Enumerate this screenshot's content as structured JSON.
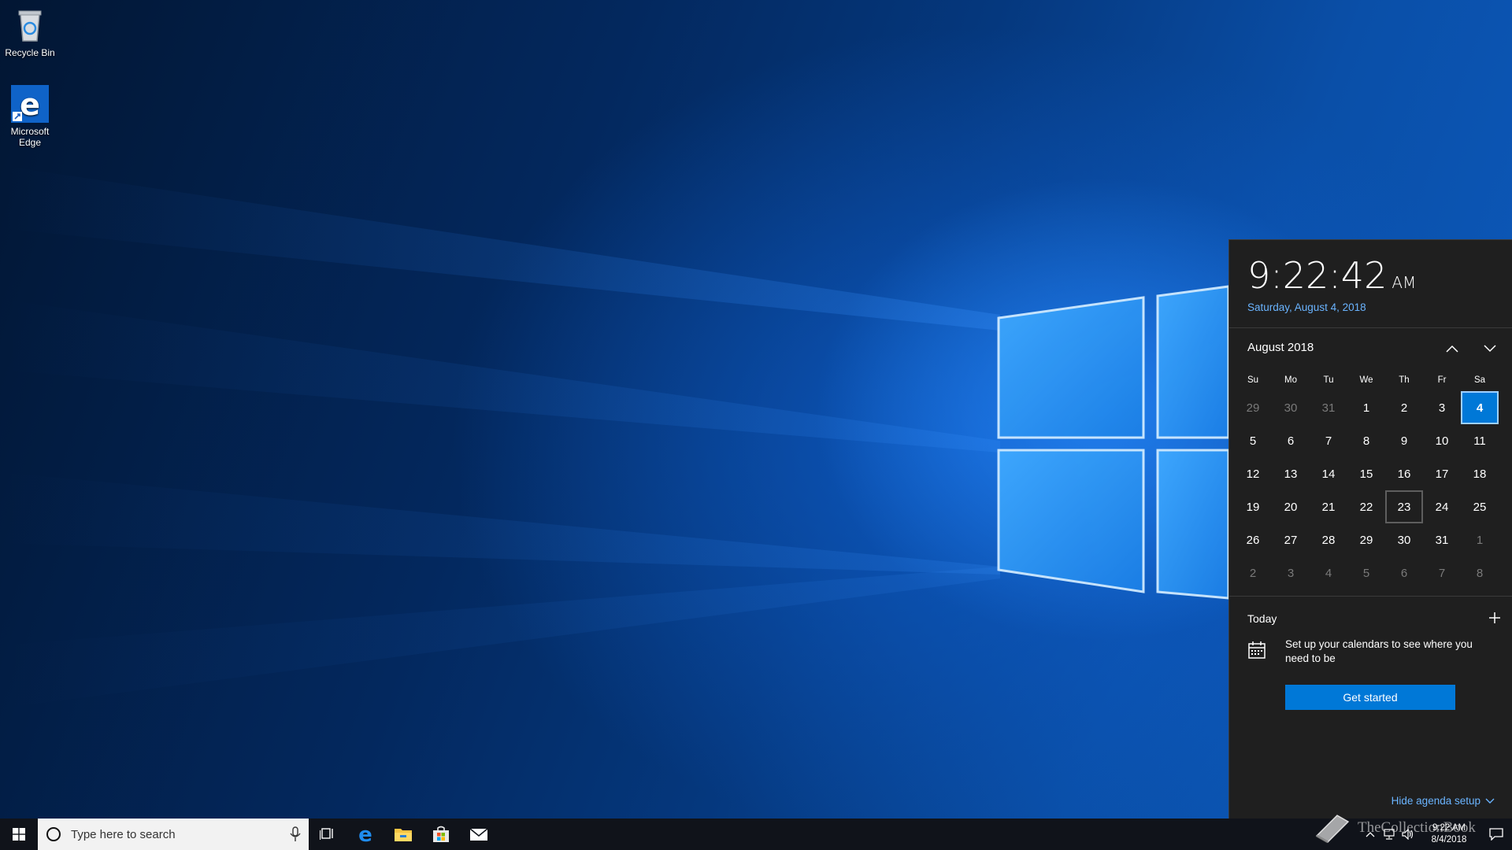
{
  "desktop": {
    "icons": [
      {
        "label": "Recycle Bin",
        "icon": "recycle-bin-icon"
      },
      {
        "label": "Microsoft Edge",
        "icon": "edge-icon"
      }
    ]
  },
  "flyout": {
    "time": "9:22:42",
    "ampm": "AM",
    "long_date": "Saturday, August 4, 2018",
    "month_label": "August 2018",
    "weekdays": [
      "Su",
      "Mo",
      "Tu",
      "We",
      "Th",
      "Fr",
      "Sa"
    ],
    "weeks": [
      [
        {
          "d": "29",
          "dim": true
        },
        {
          "d": "30",
          "dim": true
        },
        {
          "d": "31",
          "dim": true
        },
        {
          "d": "1"
        },
        {
          "d": "2"
        },
        {
          "d": "3"
        },
        {
          "d": "4",
          "today": true
        }
      ],
      [
        {
          "d": "5"
        },
        {
          "d": "6"
        },
        {
          "d": "7"
        },
        {
          "d": "8"
        },
        {
          "d": "9"
        },
        {
          "d": "10"
        },
        {
          "d": "11"
        }
      ],
      [
        {
          "d": "12"
        },
        {
          "d": "13"
        },
        {
          "d": "14"
        },
        {
          "d": "15"
        },
        {
          "d": "16"
        },
        {
          "d": "17"
        },
        {
          "d": "18"
        }
      ],
      [
        {
          "d": "19"
        },
        {
          "d": "20"
        },
        {
          "d": "21"
        },
        {
          "d": "22"
        },
        {
          "d": "23",
          "hover": true
        },
        {
          "d": "24"
        },
        {
          "d": "25"
        }
      ],
      [
        {
          "d": "26"
        },
        {
          "d": "27"
        },
        {
          "d": "28"
        },
        {
          "d": "29"
        },
        {
          "d": "30"
        },
        {
          "d": "31"
        },
        {
          "d": "1",
          "dim": true
        }
      ],
      [
        {
          "d": "2",
          "dim": true
        },
        {
          "d": "3",
          "dim": true
        },
        {
          "d": "4",
          "dim": true
        },
        {
          "d": "5",
          "dim": true
        },
        {
          "d": "6",
          "dim": true
        },
        {
          "d": "7",
          "dim": true
        },
        {
          "d": "8",
          "dim": true
        }
      ]
    ],
    "agenda": {
      "title": "Today",
      "setup_text": "Set up your calendars to see where you need to be",
      "button_label": "Get started",
      "hide_label": "Hide agenda setup"
    }
  },
  "taskbar": {
    "search_placeholder": "Type here to search",
    "pinned": [
      "task-view-icon",
      "edge-icon",
      "file-explorer-icon",
      "store-icon",
      "mail-icon"
    ],
    "clock_time": "9:22 AM",
    "clock_date": "8/4/2018"
  },
  "watermark": {
    "text": "TheCollectionBook"
  },
  "colors": {
    "accent": "#0078d7",
    "flyout_bg": "#1f1f1f",
    "link": "#6ab4ff",
    "taskbar_bg": "#10131a"
  }
}
